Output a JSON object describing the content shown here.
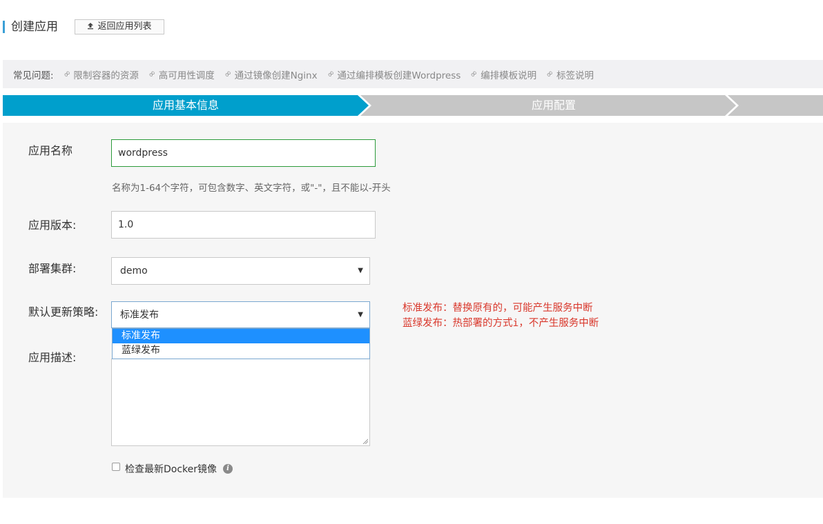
{
  "header": {
    "title": "创建应用",
    "back_label": "返回应用列表",
    "back_icon": "upload-arrow-icon"
  },
  "faq": {
    "label": "常见问题:",
    "icon": "link-icon",
    "items": [
      "限制容器的资源",
      "高可用性调度",
      "通过镜像创建Nginx",
      "通过编排模板创建Wordpress",
      "编排模板说明",
      "标签说明"
    ]
  },
  "steps": [
    {
      "label": "应用基本信息",
      "active": true
    },
    {
      "label": "应用配置",
      "active": false
    }
  ],
  "colors": {
    "step_active": "#009fcc",
    "step_inactive": "#c6c6c6",
    "note_red": "#d9382c",
    "focus_green": "#2b9a3a",
    "selected_option": "#1e90ff"
  },
  "form": {
    "name_label": "应用名称",
    "name_value": "wordpress",
    "name_hint": "名称为1-64个字符，可包含数字、英文字符，或\"-\"，且不能以-开头",
    "version_label": "应用版本:",
    "version_value": "1.0",
    "cluster_label": "部署集群:",
    "cluster_value": "demo",
    "strategy_label": "默认更新策略:",
    "strategy_value": "标准发布",
    "strategy_options": [
      "标准发布",
      "蓝绿发布"
    ],
    "strategy_note_1": "标准发布：替换原有的，可能产生服务中断",
    "strategy_note_2": "蓝绿发布：热部署的方式i，不产生服务中断",
    "desc_label": "应用描述:",
    "desc_value": "",
    "check_label": "检查最新Docker镜像",
    "check_checked": false,
    "info_icon": "info-icon"
  }
}
